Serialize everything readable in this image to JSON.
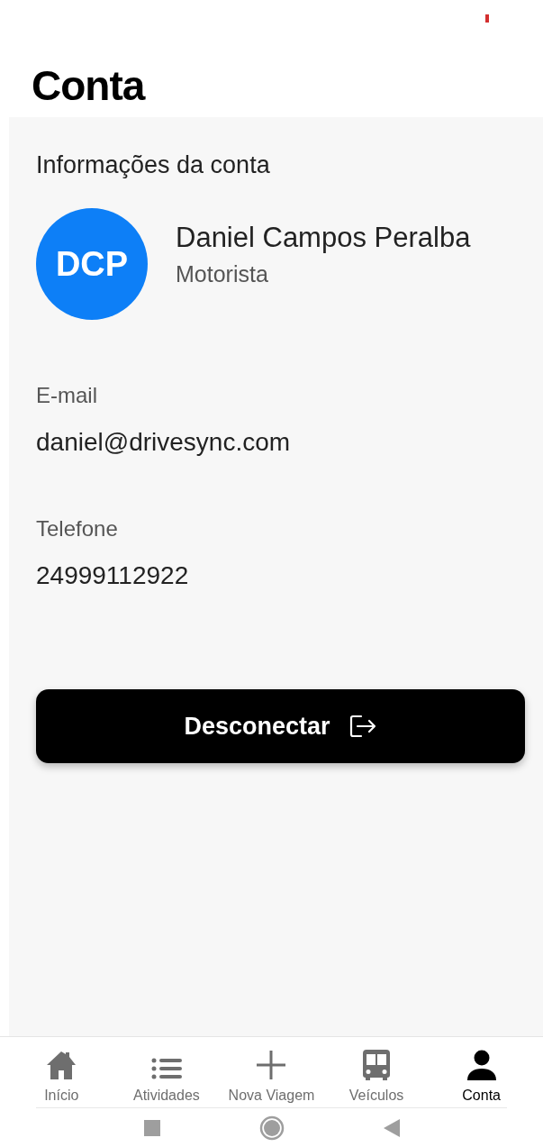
{
  "title": "Conta",
  "account": {
    "section_title": "Informações da conta",
    "initials": "DCP",
    "name": "Daniel Campos Peralba",
    "role": "Motorista",
    "fields": [
      {
        "label": "E-mail",
        "value": "daniel@drivesync.com"
      },
      {
        "label": "Telefone",
        "value": "24999112922"
      }
    ]
  },
  "logout_button": "Desconectar",
  "nav": [
    {
      "label": "Início",
      "kind": "home",
      "selected": false
    },
    {
      "label": "Atividades",
      "kind": "list",
      "selected": false
    },
    {
      "label": "Nova Viagem",
      "kind": "plus",
      "selected": false
    },
    {
      "label": "Veículos",
      "kind": "bus",
      "selected": false
    },
    {
      "label": "Conta",
      "kind": "person",
      "selected": true
    }
  ]
}
